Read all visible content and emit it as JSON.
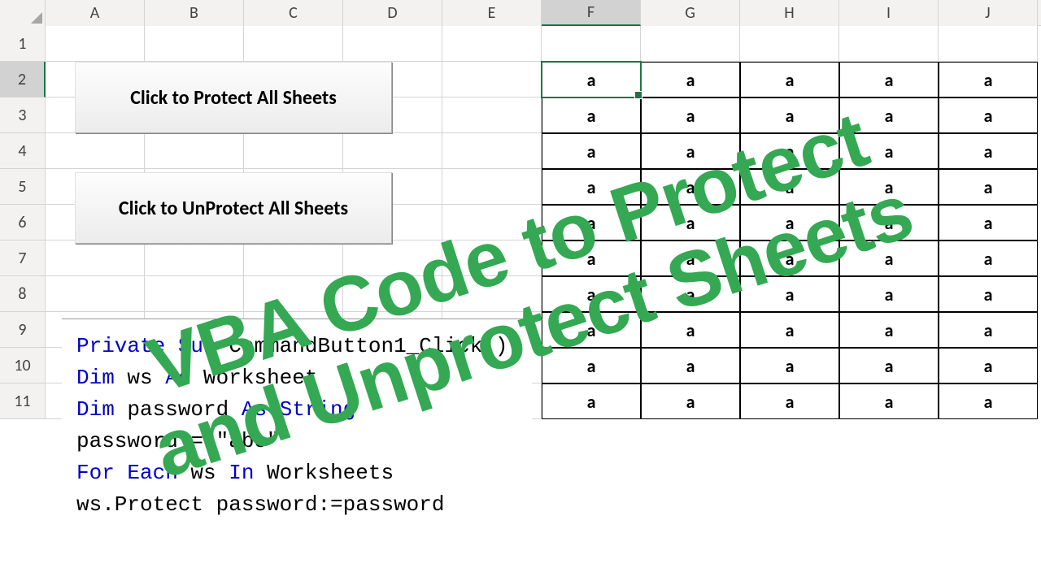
{
  "columns": [
    "A",
    "B",
    "C",
    "D",
    "E",
    "F",
    "G",
    "H",
    "I",
    "J"
  ],
  "selected_col": "F",
  "rows": [
    1,
    2,
    3,
    4,
    5,
    6,
    7,
    8,
    9,
    10,
    11
  ],
  "selected_row": 2,
  "data_range": {
    "col_start": 5,
    "col_end": 9,
    "row_start": 2,
    "row_end": 11,
    "value": "a"
  },
  "active_cell": {
    "row": 2,
    "col": 5
  },
  "button1_label": "Click to Protect All Sheets",
  "button2_label": "Click to UnProtect All Sheets",
  "code": {
    "l1a": "Private Sub",
    "l1b": " CommandButton1_Click()",
    "l2a": "Dim",
    "l2b": " ws ",
    "l2c": "As",
    "l2d": " Worksheet",
    "l3a": "Dim",
    "l3b": " password ",
    "l3c": "As String",
    "l4": "password = \"abc\"",
    "l5a": "For Each",
    "l5b": " ws ",
    "l5c": "In",
    "l5d": " Worksheets",
    "l6": "ws.Protect password:=password"
  },
  "overlay_line1": "VBA Code to Protect",
  "overlay_line2": "and Unprotect Sheets"
}
